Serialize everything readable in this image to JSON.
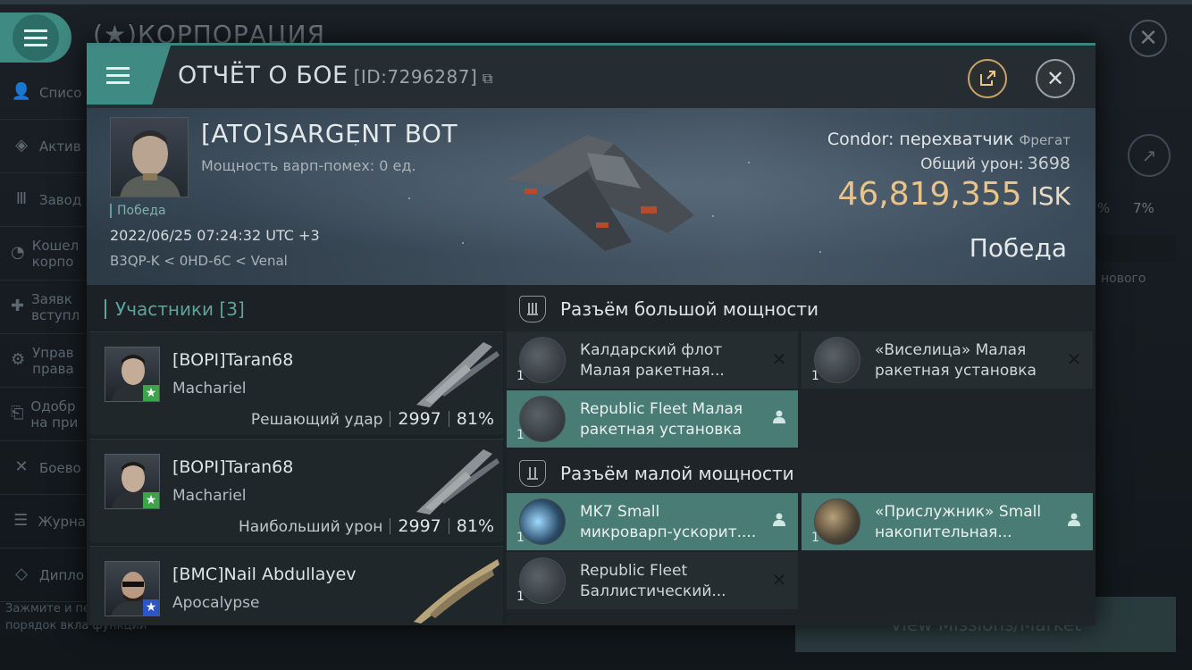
{
  "background": {
    "title": "КОРПОРАЦИЯ",
    "sidebar": [
      "Списо",
      "Актив",
      "Завод",
      "Кошел корпо",
      "Заявк вступл",
      "Управ права",
      "Одобр на при",
      "Боево",
      "Журна",
      "Дипло"
    ],
    "hint": "Зажмите и пе изменить порядок вкла функций",
    "right_pct": "7%",
    "right_new": "нового",
    "market_button": "View Missions/Market"
  },
  "header": {
    "title": "ОТЧЁТ О БОЕ",
    "id": "[ID:7296287]",
    "copy_icon": "copy-icon",
    "share_icon": "share-icon",
    "close_icon": "close-icon"
  },
  "victim": {
    "name": "[ATO]SARGENT BOT",
    "warp": "Мощность варп-помех: 0 ед.",
    "result_small": "Победа",
    "datetime": "2022/06/25 07:24:32 UTC +3",
    "location": "B3QP-K < 0HD-6C < Venal",
    "ship_type": "Condor: перехватчик",
    "ship_class": "Фрегат",
    "total_damage_label": "Общий урон:",
    "total_damage": "3698",
    "isk_value": "46,819,355",
    "isk_unit": "ISK",
    "result_big": "Победа"
  },
  "participants": {
    "title": "Участники [3]",
    "items": [
      {
        "name": "[BOPI]Taran68",
        "ship": "Machariel",
        "role": "Решающий удар",
        "damage": "2997",
        "percent": "81%"
      },
      {
        "name": "[BOPI]Taran68",
        "ship": "Machariel",
        "role": "Наибольший урон",
        "damage": "2997",
        "percent": "81%"
      },
      {
        "name": "[BMC]Nail Abdullayev",
        "ship": "Apocalypse"
      }
    ]
  },
  "slots": {
    "high": {
      "title": "Разъём большой мощности",
      "modules": [
        {
          "qty": "1",
          "line1": "Калдарский флот",
          "line2": "Малая ракетная...",
          "state": "destroyed"
        },
        {
          "qty": "1",
          "line1": "«Виселица» Малая",
          "line2": "ракетная установка",
          "state": "destroyed"
        },
        {
          "qty": "1",
          "line1": "Republic Fleet Малая",
          "line2": "ракетная установка",
          "state": "dropped"
        }
      ]
    },
    "low": {
      "title": "Разъём малой мощности",
      "modules": [
        {
          "qty": "1",
          "line1": "MK7 Small",
          "line2": "микроварп-ускорит....",
          "state": "dropped"
        },
        {
          "qty": "1",
          "line1": "«Прислужник» Small",
          "line2": "накопительная...",
          "state": "dropped"
        },
        {
          "qty": "1",
          "line1": "Republic Fleet",
          "line2": "Баллистический...",
          "state": "destroyed"
        }
      ]
    }
  },
  "colors": {
    "accent": "#3f8a82",
    "isk": "#e8c48a",
    "highlight": "#4a7c76"
  }
}
